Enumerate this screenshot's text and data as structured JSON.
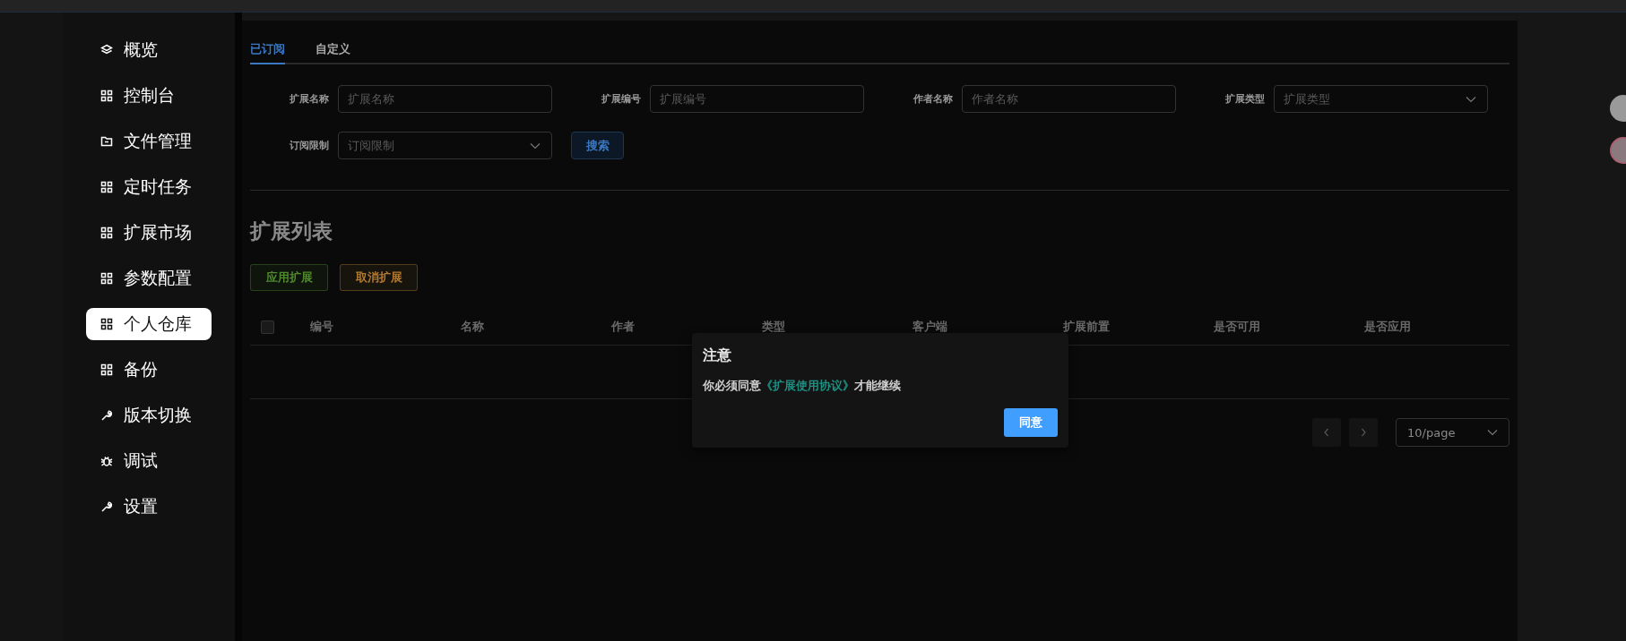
{
  "sidebar": {
    "items": [
      {
        "label": "概览",
        "kind": "layers",
        "selected": false
      },
      {
        "label": "控制台",
        "kind": "grid",
        "selected": false
      },
      {
        "label": "文件管理",
        "kind": "folder",
        "selected": false
      },
      {
        "label": "定时任务",
        "kind": "grid",
        "selected": false
      },
      {
        "label": "扩展市场",
        "kind": "grid",
        "selected": false
      },
      {
        "label": "参数配置",
        "kind": "grid",
        "selected": false
      },
      {
        "label": "个人仓库",
        "kind": "grid",
        "selected": true
      },
      {
        "label": "备份",
        "kind": "grid",
        "selected": false
      },
      {
        "label": "版本切换",
        "kind": "wrench",
        "selected": false
      },
      {
        "label": "调试",
        "kind": "bug",
        "selected": false
      },
      {
        "label": "设置",
        "kind": "wrench",
        "selected": false
      }
    ]
  },
  "tabs": [
    {
      "label": "已订阅",
      "selected": true
    },
    {
      "label": "自定义",
      "selected": false
    }
  ],
  "filters": [
    {
      "label": "扩展名称",
      "placeholder": "扩展名称",
      "kind": "input"
    },
    {
      "label": "扩展编号",
      "placeholder": "扩展编号",
      "kind": "input"
    },
    {
      "label": "作者名称",
      "placeholder": "作者名称",
      "kind": "input"
    },
    {
      "label": "扩展类型",
      "placeholder": "扩展类型",
      "kind": "select"
    },
    {
      "label": "订阅限制",
      "placeholder": "订阅限制",
      "kind": "select"
    }
  ],
  "search_button": "搜索",
  "section_title": "扩展列表",
  "actions": [
    {
      "label": "应用扩展",
      "color": "#4f8a2c"
    },
    {
      "label": "取消扩展",
      "color": "#b57a2e"
    }
  ],
  "table": {
    "select_all": {
      "checked": false
    },
    "columns": [
      "编号",
      "名称",
      "作者",
      "类型",
      "客户端",
      "扩展前置",
      "是否可用",
      "是否应用"
    ]
  },
  "pagination": {
    "page_size": "10/page"
  },
  "dialog": {
    "title": "注意",
    "message_start": "你必须同意",
    "link": "《扩展使用协议》",
    "message_end": "才能继续",
    "button": "同意"
  }
}
